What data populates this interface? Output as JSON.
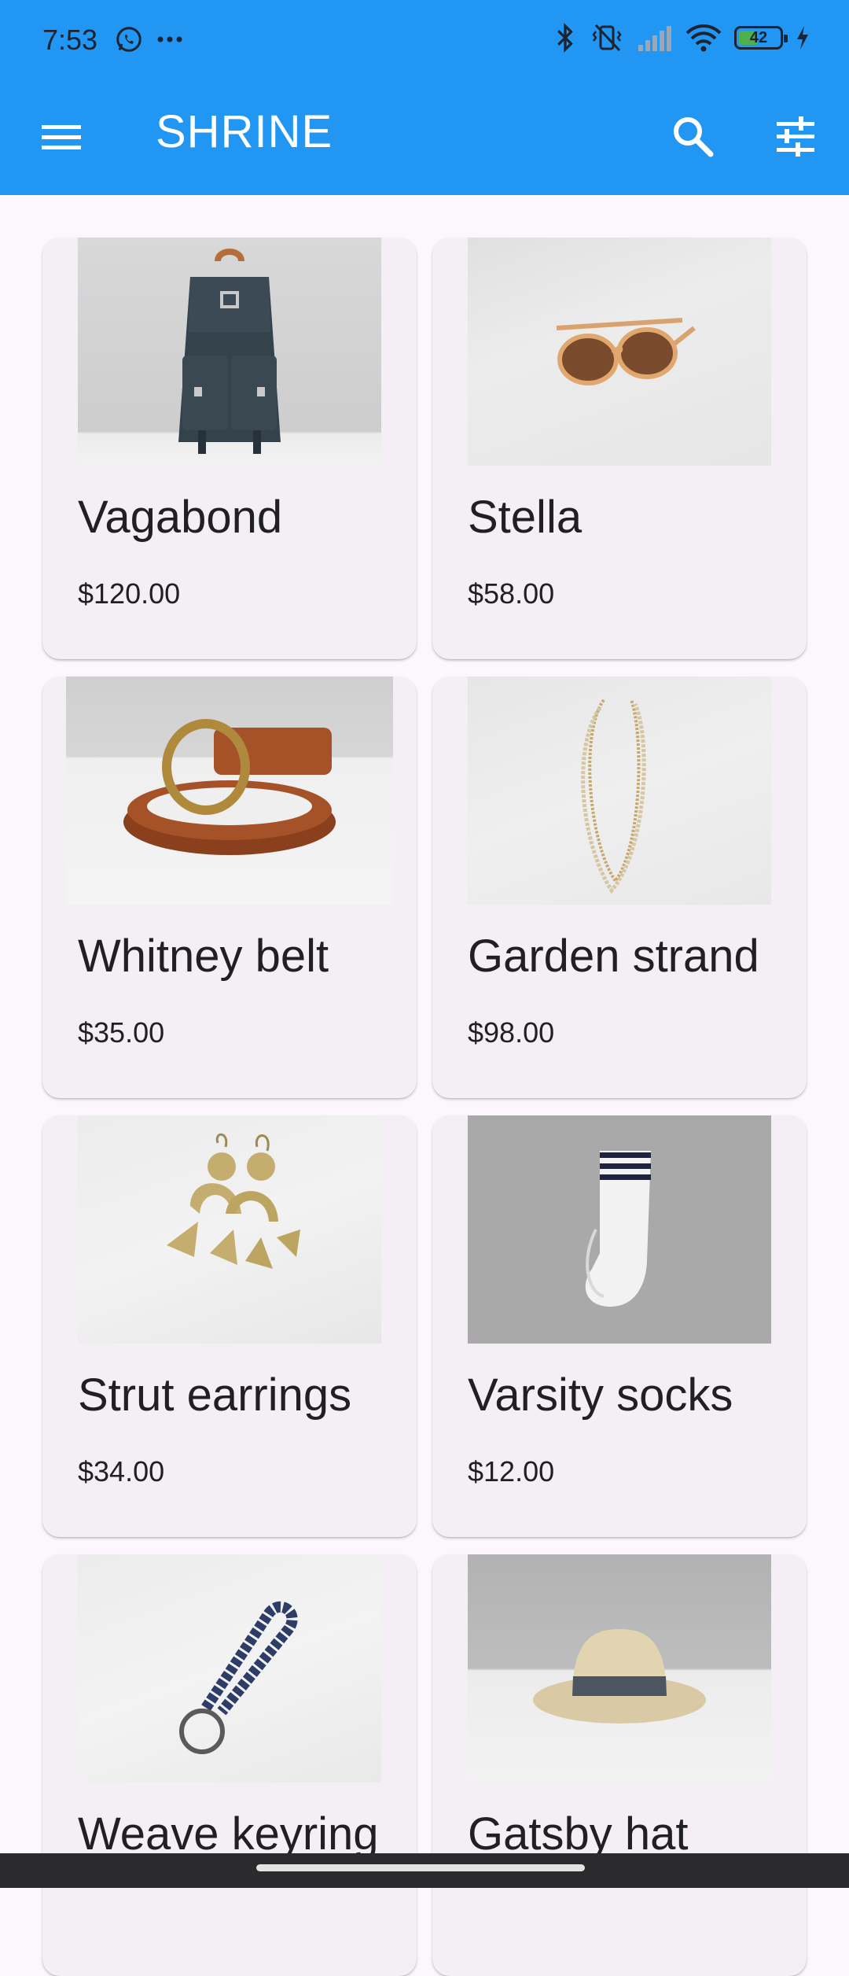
{
  "status_bar": {
    "time": "7:53",
    "battery": "42",
    "left_icons": [
      "whatsapp-icon",
      "more-dots-icon"
    ],
    "right_icons": [
      "bluetooth-icon",
      "vibrate-off-icon",
      "signal-icon",
      "wifi-icon",
      "battery-icon",
      "charging-icon"
    ]
  },
  "app_bar": {
    "title": "SHRINE",
    "menu_icon": "menu-icon",
    "search_icon": "search-icon",
    "filter_icon": "tune-icon",
    "color": "#2196f3"
  },
  "products": [
    {
      "name": "Vagabond",
      "price": "$120.00",
      "image": "backpack"
    },
    {
      "name": "Stella",
      "price": "$58.00",
      "image": "sunglasses"
    },
    {
      "name": "Whitney belt",
      "price": "$35.00",
      "image": "belt"
    },
    {
      "name": "Garden strand",
      "price": "$98.00",
      "image": "necklace"
    },
    {
      "name": "Strut earrings",
      "price": "$34.00",
      "image": "earrings"
    },
    {
      "name": "Varsity socks",
      "price": "$12.00",
      "image": "socks"
    },
    {
      "name": "Weave keyring",
      "price": "",
      "image": "keyring"
    },
    {
      "name": "Gatsby hat",
      "price": "",
      "image": "hat"
    }
  ]
}
